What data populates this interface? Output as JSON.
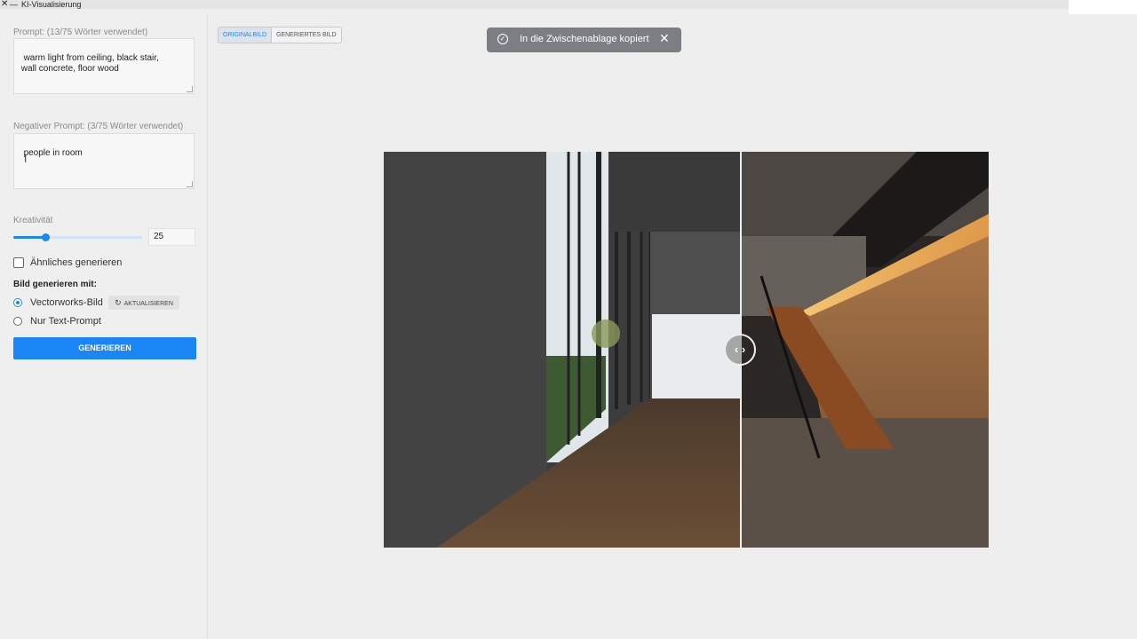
{
  "window": {
    "title": "KI-Visualisierung",
    "close_glyph": "✕",
    "min_glyph": "—"
  },
  "sidebar": {
    "prompt_label": "Prompt: (13/75 Wörter verwendet)",
    "prompt_value": "warm light from ceiling, black stair,\n wall concrete, floor wood",
    "neg_prompt_label": "Negativer Prompt: (3/75 Wörter verwendet)",
    "neg_prompt_value": "people in room",
    "creativity_label": "Kreativität",
    "creativity_value": "25",
    "creativity_level": 25,
    "similar_label": "Ähnliches generieren",
    "similar_checked": false,
    "generate_with_label": "Bild generieren mit:",
    "option_vectorworks": "Vectorworks-Bild",
    "option_text": "Nur Text-Prompt",
    "selected_option": "Vectorworks-Bild",
    "update_label": "AKTUALISIEREN",
    "generate_label": "GENERIEREN"
  },
  "view_toggle": {
    "original": "ORIGINALBILD",
    "generated": "GENERIERTES BILD",
    "active": "ORIGINALBILD"
  },
  "toast": {
    "message": "In die Zwischenablage kopiert"
  },
  "compare": {
    "handle_left": "‹",
    "handle_right": "›",
    "split_fraction": 0.59
  },
  "colors": {
    "accent": "#1e88f0",
    "generate_button": "#1a86f5",
    "toast_bg": "#7b7f84"
  }
}
